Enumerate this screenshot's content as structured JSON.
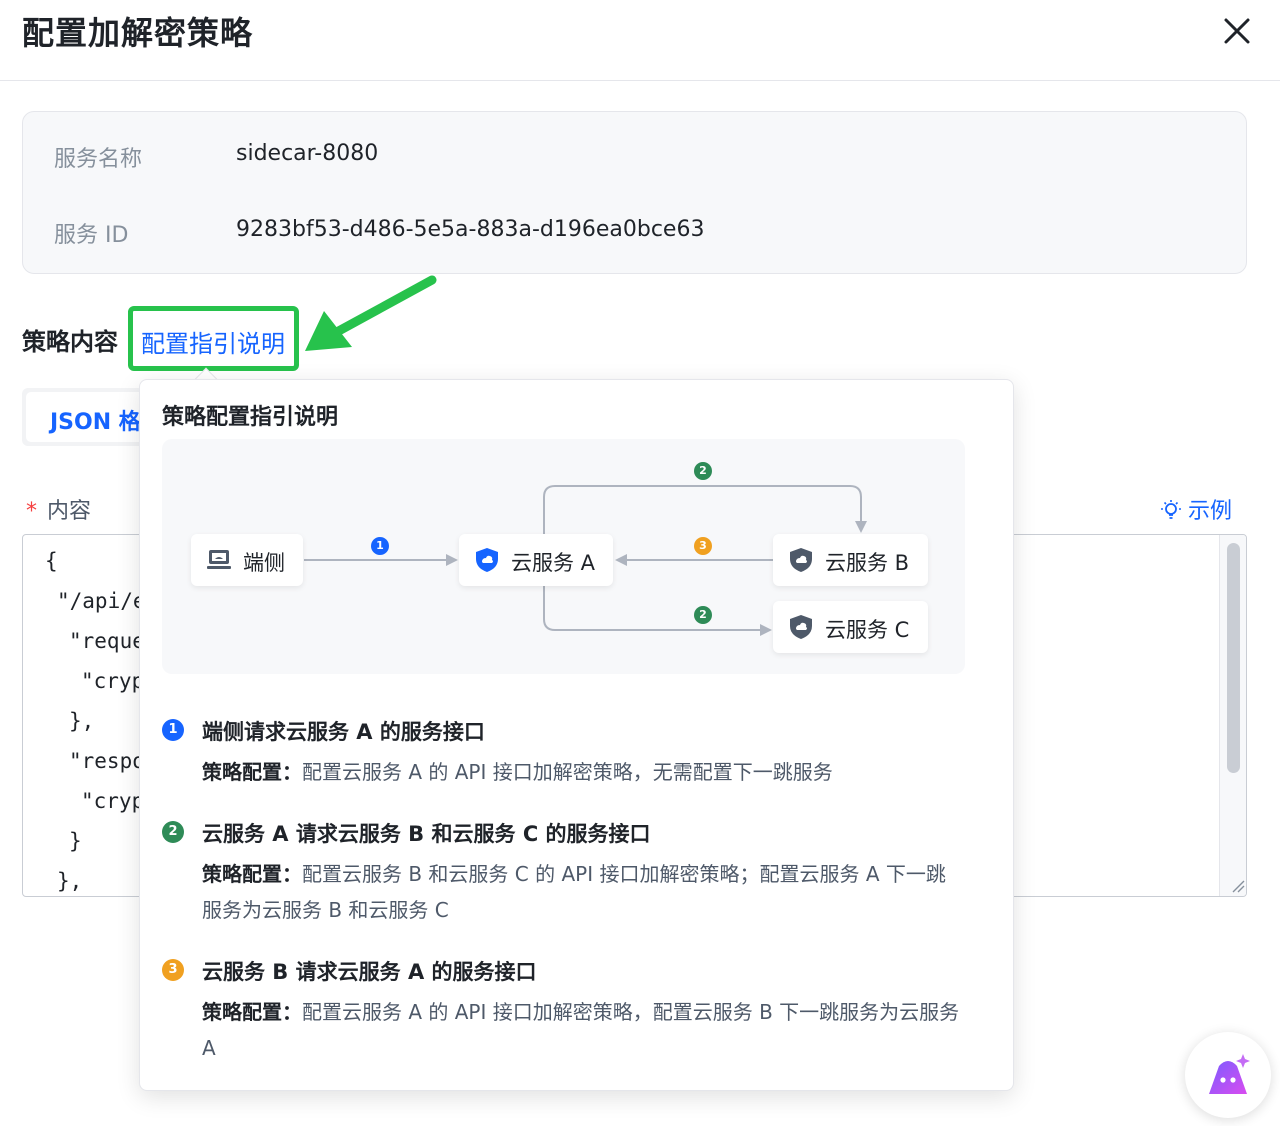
{
  "dialog": {
    "title": "配置加解密策略"
  },
  "service": {
    "name_label": "服务名称",
    "name_value": "sidecar-8080",
    "id_label": "服务 ID",
    "id_value": "9283bf53-d486-5e5a-883a-d196ea0bce63"
  },
  "policy": {
    "label": "策略内容",
    "guide_link": "配置指引说明",
    "format_tab": "JSON 格",
    "content_required": "*",
    "content_label": "内容",
    "example_link": "示例",
    "code_lines": [
      "{",
      "\"/api/en",
      "\"reque:",
      "\"crypt",
      "},",
      "\"respo",
      "\"crypt",
      "}",
      "},"
    ]
  },
  "guide": {
    "title": "策略配置指引说明",
    "diagram": {
      "client": "端侧",
      "service_a": "云服务 A",
      "service_b": "云服务 B",
      "service_c": "云服务 C",
      "edge_labels": [
        "1",
        "2",
        "3",
        "2"
      ]
    },
    "steps": [
      {
        "num": "1",
        "color": "#1664ff",
        "title": "端侧请求云服务 A 的服务接口",
        "desc_key": "策略配置：",
        "desc": "配置云服务 A 的 API 接口加解密策略，无需配置下一跳服务"
      },
      {
        "num": "2",
        "color": "#2e8b57",
        "title": "云服务 A 请求云服务 B 和云服务 C 的服务接口",
        "desc_key": "策略配置：",
        "desc": "配置云服务 B 和云服务 C 的 API 接口加解密策略；配置云服务 A 下一跳服务为云服务 B 和云服务 C"
      },
      {
        "num": "3",
        "color": "#f0a020",
        "title": "云服务 B 请求云服务 A 的服务接口",
        "desc_key": "策略配置：",
        "desc": "配置云服务 A 的 API 接口加解密策略，配置云服务 B 下一跳服务为云服务 A"
      }
    ]
  },
  "colors": {
    "primary": "#1664ff",
    "highlight": "#27c24c",
    "step1": "#1664ff",
    "step2": "#2e8b57",
    "step3": "#f0a020"
  }
}
